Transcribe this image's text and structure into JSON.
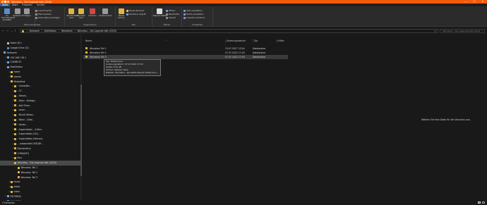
{
  "window": {
    "title": "Winnetou - Die Legende lebt (2016)",
    "min_glyph": "—",
    "max_glyph": "□",
    "close_glyph": "✕"
  },
  "tabs": [
    {
      "label": "Datei"
    },
    {
      "label": "Start"
    },
    {
      "label": "Freigeben"
    },
    {
      "label": "Ansicht"
    }
  ],
  "ribbon": {
    "clipboard": {
      "group_label": "Zwischenablage",
      "pin_label": "An Schnellzugriff anheften",
      "copy_label": "Kopieren",
      "paste_label": "Einfügen",
      "cut_label": "Ausschneiden",
      "copy_path_label": "Pfad kopieren",
      "paste_shortcut_label": "Verknüpfung einfügen"
    },
    "organize": {
      "group_label": "Organisieren",
      "move_label": "Verschieben nach",
      "copy_to_label": "Kopieren nach",
      "delete_label": "Löschen",
      "rename_label": "Umbenennen"
    },
    "new": {
      "group_label": "Neu",
      "new_folder_label": "Neuer Ordner",
      "new_item_label": "Neues Element",
      "easy_access_label": "Einfacher Zugriff"
    },
    "open": {
      "group_label": "Öffnen",
      "properties_label": "Eigenschaften",
      "open_label": "Öffnen",
      "edit_label": "Bearbeiten",
      "history_label": "Verlauf"
    },
    "select": {
      "group_label": "Auswählen",
      "select_all_label": "Alles auswählen",
      "select_none_label": "Nichts auswählen",
      "invert_label": "Auswahl umkehren"
    }
  },
  "address": {
    "back": "←",
    "forward": "→",
    "recent": "⌄",
    "up": "↑",
    "crumbs": [
      "Netzwerk",
      "DiskStation",
      "Mediathek",
      "Winnetou - Die Legende lebt (2016)"
    ],
    "separator": ">",
    "refresh": "⟳",
    "search_placeholder": "\"Winnetou - Die Legende lebt (2016)\" durchsuchen",
    "search_icon": "⌕"
  },
  "nav": {
    "chev_closed": ">",
    "chev_open": "⌄",
    "items": [
      {
        "label": "Daten (D:)",
        "icon": "drive",
        "level": 1,
        "chev": ""
      },
      {
        "label": "Google Drive (G:)",
        "icon": "cloud",
        "level": 1,
        "chev": ""
      },
      {
        "label": "Netzwerk",
        "icon": "net",
        "level": 0,
        "chev": "open"
      },
      {
        "label": "192.168.178.1",
        "icon": "net",
        "level": 1,
        "chev": "closed"
      },
      {
        "label": "COMMI-PC",
        "icon": "net",
        "level": 1,
        "chev": "closed"
      },
      {
        "label": "DiskStation",
        "icon": "net",
        "level": 1,
        "chev": "open"
      },
      {
        "label": "home",
        "icon": "folder",
        "level": 2,
        "chev": "closed"
      },
      {
        "label": "homes",
        "icon": "folder",
        "level": 2,
        "chev": "closed"
      },
      {
        "label": "Mediathek",
        "icon": "folder",
        "level": 2,
        "chev": "open"
      },
      {
        "label": "- Comedian -",
        "icon": "folder",
        "level": 3,
        "chev": "closed"
      },
      {
        "label": "- CT -",
        "icon": "folder",
        "level": 3,
        "chev": "closed"
      },
      {
        "label": "- Disney -",
        "icon": "folder",
        "level": 3,
        "chev": "closed"
      },
      {
        "label": "- Doku - Dialoge -",
        "icon": "folder",
        "level": 3,
        "chev": "closed"
      },
      {
        "label": "- Kult Filme -",
        "icon": "folder",
        "level": 3,
        "chev": "closed"
      },
      {
        "label": "- Laser -",
        "icon": "folder",
        "level": 3,
        "chev": "closed"
      },
      {
        "label": "- Musik Videos -",
        "icon": "folder",
        "level": 3,
        "chev": "closed"
      },
      {
        "label": "- Natur - Doku -",
        "icon": "folder",
        "level": 3,
        "chev": "closed"
      },
      {
        "label": "- Serien -",
        "icon": "folder",
        "level": 3,
        "chev": "closed"
      },
      {
        "label": "- Superhelden - X-Men -",
        "icon": "folder",
        "level": 3,
        "chev": "closed"
      },
      {
        "label": "- Superhelden (DC) -",
        "icon": "folder",
        "level": 3,
        "chev": "closed"
      },
      {
        "label": "- Superhelden (Marvel) -",
        "icon": "folder",
        "level": 3,
        "chev": "closed"
      },
      {
        "label": "-- unbeachtet DVD-BR --",
        "icon": "folder",
        "level": 3,
        "chev": "closed"
      },
      {
        "label": "Zeichentrick",
        "icon": "folder",
        "level": 3,
        "chev": "closed"
      },
      {
        "label": "3 PIRANTH",
        "icon": "folder",
        "level": 3,
        "chev": "closed"
      },
      {
        "label": "Neu",
        "icon": "folder",
        "level": 3,
        "chev": "closed"
      },
      {
        "label": "Winnetou - Die Legende lebt (2016)",
        "icon": "folder",
        "level": 3,
        "chev": "open",
        "selected": true
      },
      {
        "label": "Winnetou Teil 1",
        "icon": "folder",
        "level": 4,
        "chev": ""
      },
      {
        "label": "Winnetou Teil 2",
        "icon": "folder",
        "level": 4,
        "chev": ""
      },
      {
        "label": "Winnetou Teil 3",
        "icon": "folder",
        "level": 4,
        "chev": ""
      },
      {
        "label": "music",
        "icon": "folder",
        "level": 2,
        "chev": "closed"
      },
      {
        "label": "photo",
        "icon": "folder",
        "level": 2,
        "chev": "closed"
      },
      {
        "label": "video",
        "icon": "folder",
        "level": 2,
        "chev": "closed"
      },
      {
        "label": "FRITZBOX",
        "icon": "net",
        "level": 1,
        "chev": "closed"
      },
      {
        "label": "NAS-3700",
        "icon": "net",
        "level": 1,
        "chev": "closed"
      }
    ]
  },
  "files": {
    "columns": [
      "Name",
      "Änderungsdatum",
      "Typ",
      "Größe"
    ],
    "sort_indicator": "^",
    "rows": [
      {
        "name": "Winnetou Teil 1",
        "date": "23.07.2017 13:24",
        "type": "Dateiordner",
        "size": ""
      },
      {
        "name": "Winnetou Teil 2",
        "date": "07.07.2022 17:43",
        "type": "Dateiordner",
        "size": ""
      },
      {
        "name": "Winnetou Teil 3",
        "date": "07.07.2022 17:43",
        "type": "Dateiordner",
        "size": "",
        "selected": true
      }
    ]
  },
  "tooltip": {
    "lines": [
      "Typ: Dateiordner",
      "Änderungsdatum: 07.07.2022 17:43",
      "Größe: 5,25 GB",
      "Ordner: Sample, Subs",
      "Dateien: Winnetou - Die letzte Kampf (2016).mkv, ..."
    ]
  },
  "preview": {
    "message": "Wählen Sie eine Datei für die Vorschau aus."
  },
  "status": {
    "text": "3 Elemente"
  }
}
